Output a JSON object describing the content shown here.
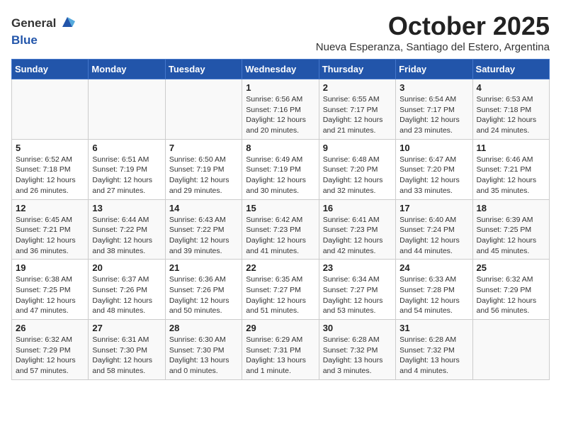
{
  "header": {
    "logo_line1": "General",
    "logo_line2": "Blue",
    "month": "October 2025",
    "subtitle": "Nueva Esperanza, Santiago del Estero, Argentina"
  },
  "weekdays": [
    "Sunday",
    "Monday",
    "Tuesday",
    "Wednesday",
    "Thursday",
    "Friday",
    "Saturday"
  ],
  "weeks": [
    [
      {
        "day": "",
        "info": ""
      },
      {
        "day": "",
        "info": ""
      },
      {
        "day": "",
        "info": ""
      },
      {
        "day": "1",
        "info": "Sunrise: 6:56 AM\nSunset: 7:16 PM\nDaylight: 12 hours\nand 20 minutes."
      },
      {
        "day": "2",
        "info": "Sunrise: 6:55 AM\nSunset: 7:17 PM\nDaylight: 12 hours\nand 21 minutes."
      },
      {
        "day": "3",
        "info": "Sunrise: 6:54 AM\nSunset: 7:17 PM\nDaylight: 12 hours\nand 23 minutes."
      },
      {
        "day": "4",
        "info": "Sunrise: 6:53 AM\nSunset: 7:18 PM\nDaylight: 12 hours\nand 24 minutes."
      }
    ],
    [
      {
        "day": "5",
        "info": "Sunrise: 6:52 AM\nSunset: 7:18 PM\nDaylight: 12 hours\nand 26 minutes."
      },
      {
        "day": "6",
        "info": "Sunrise: 6:51 AM\nSunset: 7:19 PM\nDaylight: 12 hours\nand 27 minutes."
      },
      {
        "day": "7",
        "info": "Sunrise: 6:50 AM\nSunset: 7:19 PM\nDaylight: 12 hours\nand 29 minutes."
      },
      {
        "day": "8",
        "info": "Sunrise: 6:49 AM\nSunset: 7:19 PM\nDaylight: 12 hours\nand 30 minutes."
      },
      {
        "day": "9",
        "info": "Sunrise: 6:48 AM\nSunset: 7:20 PM\nDaylight: 12 hours\nand 32 minutes."
      },
      {
        "day": "10",
        "info": "Sunrise: 6:47 AM\nSunset: 7:20 PM\nDaylight: 12 hours\nand 33 minutes."
      },
      {
        "day": "11",
        "info": "Sunrise: 6:46 AM\nSunset: 7:21 PM\nDaylight: 12 hours\nand 35 minutes."
      }
    ],
    [
      {
        "day": "12",
        "info": "Sunrise: 6:45 AM\nSunset: 7:21 PM\nDaylight: 12 hours\nand 36 minutes."
      },
      {
        "day": "13",
        "info": "Sunrise: 6:44 AM\nSunset: 7:22 PM\nDaylight: 12 hours\nand 38 minutes."
      },
      {
        "day": "14",
        "info": "Sunrise: 6:43 AM\nSunset: 7:22 PM\nDaylight: 12 hours\nand 39 minutes."
      },
      {
        "day": "15",
        "info": "Sunrise: 6:42 AM\nSunset: 7:23 PM\nDaylight: 12 hours\nand 41 minutes."
      },
      {
        "day": "16",
        "info": "Sunrise: 6:41 AM\nSunset: 7:23 PM\nDaylight: 12 hours\nand 42 minutes."
      },
      {
        "day": "17",
        "info": "Sunrise: 6:40 AM\nSunset: 7:24 PM\nDaylight: 12 hours\nand 44 minutes."
      },
      {
        "day": "18",
        "info": "Sunrise: 6:39 AM\nSunset: 7:25 PM\nDaylight: 12 hours\nand 45 minutes."
      }
    ],
    [
      {
        "day": "19",
        "info": "Sunrise: 6:38 AM\nSunset: 7:25 PM\nDaylight: 12 hours\nand 47 minutes."
      },
      {
        "day": "20",
        "info": "Sunrise: 6:37 AM\nSunset: 7:26 PM\nDaylight: 12 hours\nand 48 minutes."
      },
      {
        "day": "21",
        "info": "Sunrise: 6:36 AM\nSunset: 7:26 PM\nDaylight: 12 hours\nand 50 minutes."
      },
      {
        "day": "22",
        "info": "Sunrise: 6:35 AM\nSunset: 7:27 PM\nDaylight: 12 hours\nand 51 minutes."
      },
      {
        "day": "23",
        "info": "Sunrise: 6:34 AM\nSunset: 7:27 PM\nDaylight: 12 hours\nand 53 minutes."
      },
      {
        "day": "24",
        "info": "Sunrise: 6:33 AM\nSunset: 7:28 PM\nDaylight: 12 hours\nand 54 minutes."
      },
      {
        "day": "25",
        "info": "Sunrise: 6:32 AM\nSunset: 7:29 PM\nDaylight: 12 hours\nand 56 minutes."
      }
    ],
    [
      {
        "day": "26",
        "info": "Sunrise: 6:32 AM\nSunset: 7:29 PM\nDaylight: 12 hours\nand 57 minutes."
      },
      {
        "day": "27",
        "info": "Sunrise: 6:31 AM\nSunset: 7:30 PM\nDaylight: 12 hours\nand 58 minutes."
      },
      {
        "day": "28",
        "info": "Sunrise: 6:30 AM\nSunset: 7:30 PM\nDaylight: 13 hours\nand 0 minutes."
      },
      {
        "day": "29",
        "info": "Sunrise: 6:29 AM\nSunset: 7:31 PM\nDaylight: 13 hours\nand 1 minute."
      },
      {
        "day": "30",
        "info": "Sunrise: 6:28 AM\nSunset: 7:32 PM\nDaylight: 13 hours\nand 3 minutes."
      },
      {
        "day": "31",
        "info": "Sunrise: 6:28 AM\nSunset: 7:32 PM\nDaylight: 13 hours\nand 4 minutes."
      },
      {
        "day": "",
        "info": ""
      }
    ]
  ]
}
